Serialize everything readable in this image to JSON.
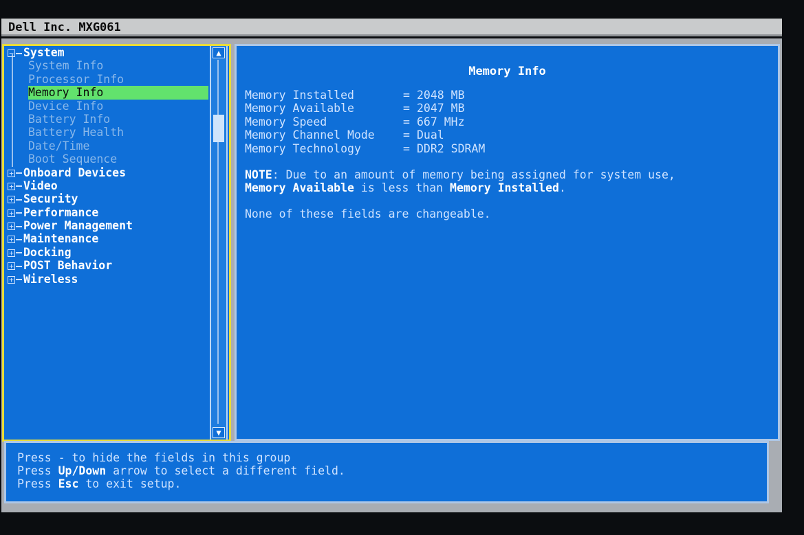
{
  "title_bar": {
    "text": "Dell Inc. MXG061"
  },
  "tree": {
    "system": {
      "label": "System",
      "items": [
        {
          "label": "System Info"
        },
        {
          "label": "Processor Info"
        },
        {
          "label": "Memory Info",
          "selected": true
        },
        {
          "label": "Device Info"
        },
        {
          "label": "Battery Info"
        },
        {
          "label": "Battery Health"
        },
        {
          "label": "Date/Time"
        },
        {
          "label": "Boot Sequence"
        }
      ]
    },
    "groups": [
      {
        "label": "Onboard Devices"
      },
      {
        "label": "Video"
      },
      {
        "label": "Security"
      },
      {
        "label": "Performance"
      },
      {
        "label": "Power Management"
      },
      {
        "label": "Maintenance"
      },
      {
        "label": "Docking"
      },
      {
        "label": "POST Behavior"
      },
      {
        "label": "Wireless"
      }
    ]
  },
  "memory_info": {
    "title": "Memory Info",
    "fields": [
      {
        "label": "Memory Installed",
        "value": "2048 MB"
      },
      {
        "label": "Memory Available",
        "value": "2047 MB"
      },
      {
        "label": "Memory Speed",
        "value": "667 MHz"
      },
      {
        "label": "Memory Channel Mode",
        "value": "Dual"
      },
      {
        "label": "Memory Technology",
        "value": "DDR2 SDRAM"
      }
    ],
    "note": {
      "prefix": "NOTE",
      "text1": ": Due to an amount of memory being assigned for system use,",
      "bold_available": "Memory Available",
      "text2": " is less than ",
      "bold_installed": "Memory Installed",
      "text3": "."
    },
    "unchangeable": "None of these fields are changeable."
  },
  "help": {
    "line1": "Press - to hide the fields in this group",
    "line2_pre": "Press ",
    "line2_key": "Up/Down",
    "line2_post": " arrow to select a different field.",
    "line3_pre": "Press ",
    "line3_key": "Esc",
    "line3_post": " to exit setup."
  },
  "colors": {
    "panel_blue": "#0f6fd8",
    "selection_green": "#62e26d",
    "left_border_yellow": "#e8dc3a",
    "title_gray": "#c9cbcc"
  }
}
